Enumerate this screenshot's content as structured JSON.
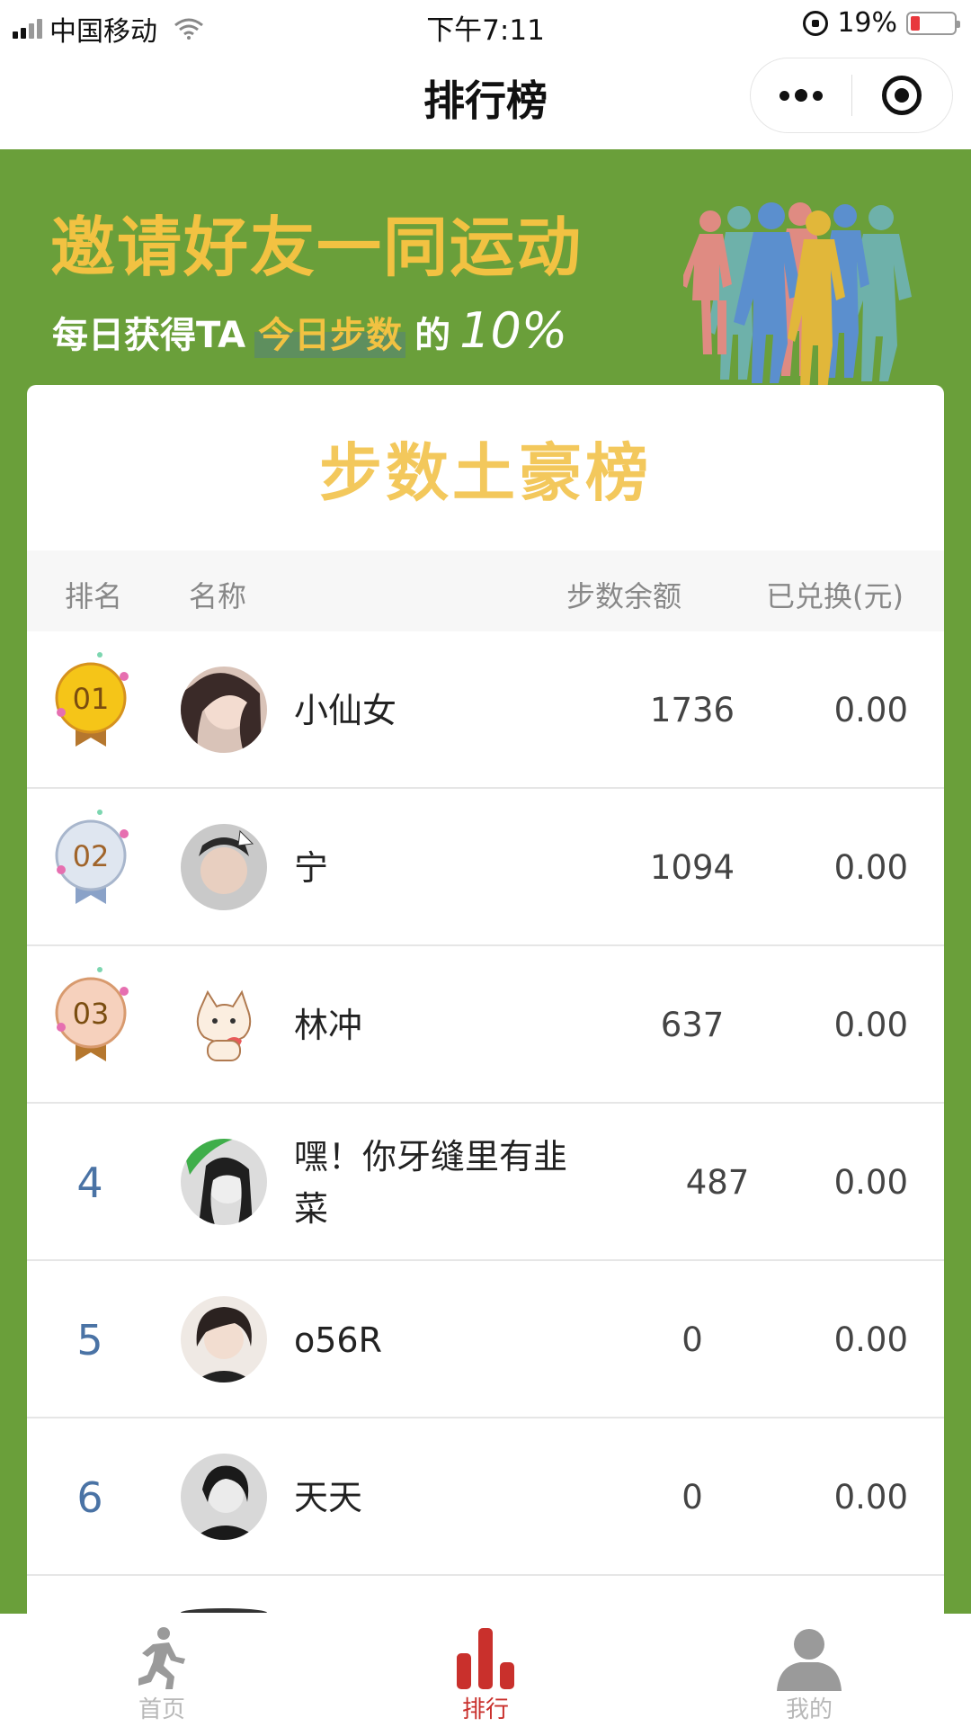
{
  "status_bar": {
    "carrier": "中国移动",
    "time": "下午7:11",
    "battery": "19%"
  },
  "nav": {
    "title": "排行榜"
  },
  "banner": {
    "title": "邀请好友一同运动",
    "sub_prefix": "每日获得TA",
    "sub_highlight": "今日步数",
    "sub_suffix": "的",
    "sub_percent": "10%"
  },
  "card": {
    "title": "步数土豪榜",
    "headers": {
      "rank": "排名",
      "name": "名称",
      "steps": "步数余额",
      "exchanged": "已兑换(元)"
    },
    "rows": [
      {
        "rank": "01",
        "name": "小仙女",
        "steps": "1736",
        "exchanged": "0.00"
      },
      {
        "rank": "02",
        "name": "宁",
        "steps": "1094",
        "exchanged": "0.00"
      },
      {
        "rank": "03",
        "name": "林冲",
        "steps": "637",
        "exchanged": "0.00"
      },
      {
        "rank": "4",
        "name": "嘿！你牙缝里有韭菜",
        "steps": "487",
        "exchanged": "0.00"
      },
      {
        "rank": "5",
        "name": "o56R",
        "steps": "0",
        "exchanged": "0.00"
      },
      {
        "rank": "6",
        "name": "天天",
        "steps": "0",
        "exchanged": "0.00"
      }
    ]
  },
  "tabs": [
    {
      "label": "首页",
      "icon": "runner-icon",
      "active": false
    },
    {
      "label": "排行",
      "icon": "bar-chart-icon",
      "active": true
    },
    {
      "label": "我的",
      "icon": "user-icon",
      "active": false
    }
  ],
  "colors": {
    "banner_green": "#6a9f3a",
    "gold": "#f2c242",
    "rank_blue": "#4a73a5",
    "active_red": "#c9302c",
    "gold_medal": "#f5c518",
    "silver_medal": "#dfe6f0",
    "bronze_medal": "#f6d1bd"
  }
}
